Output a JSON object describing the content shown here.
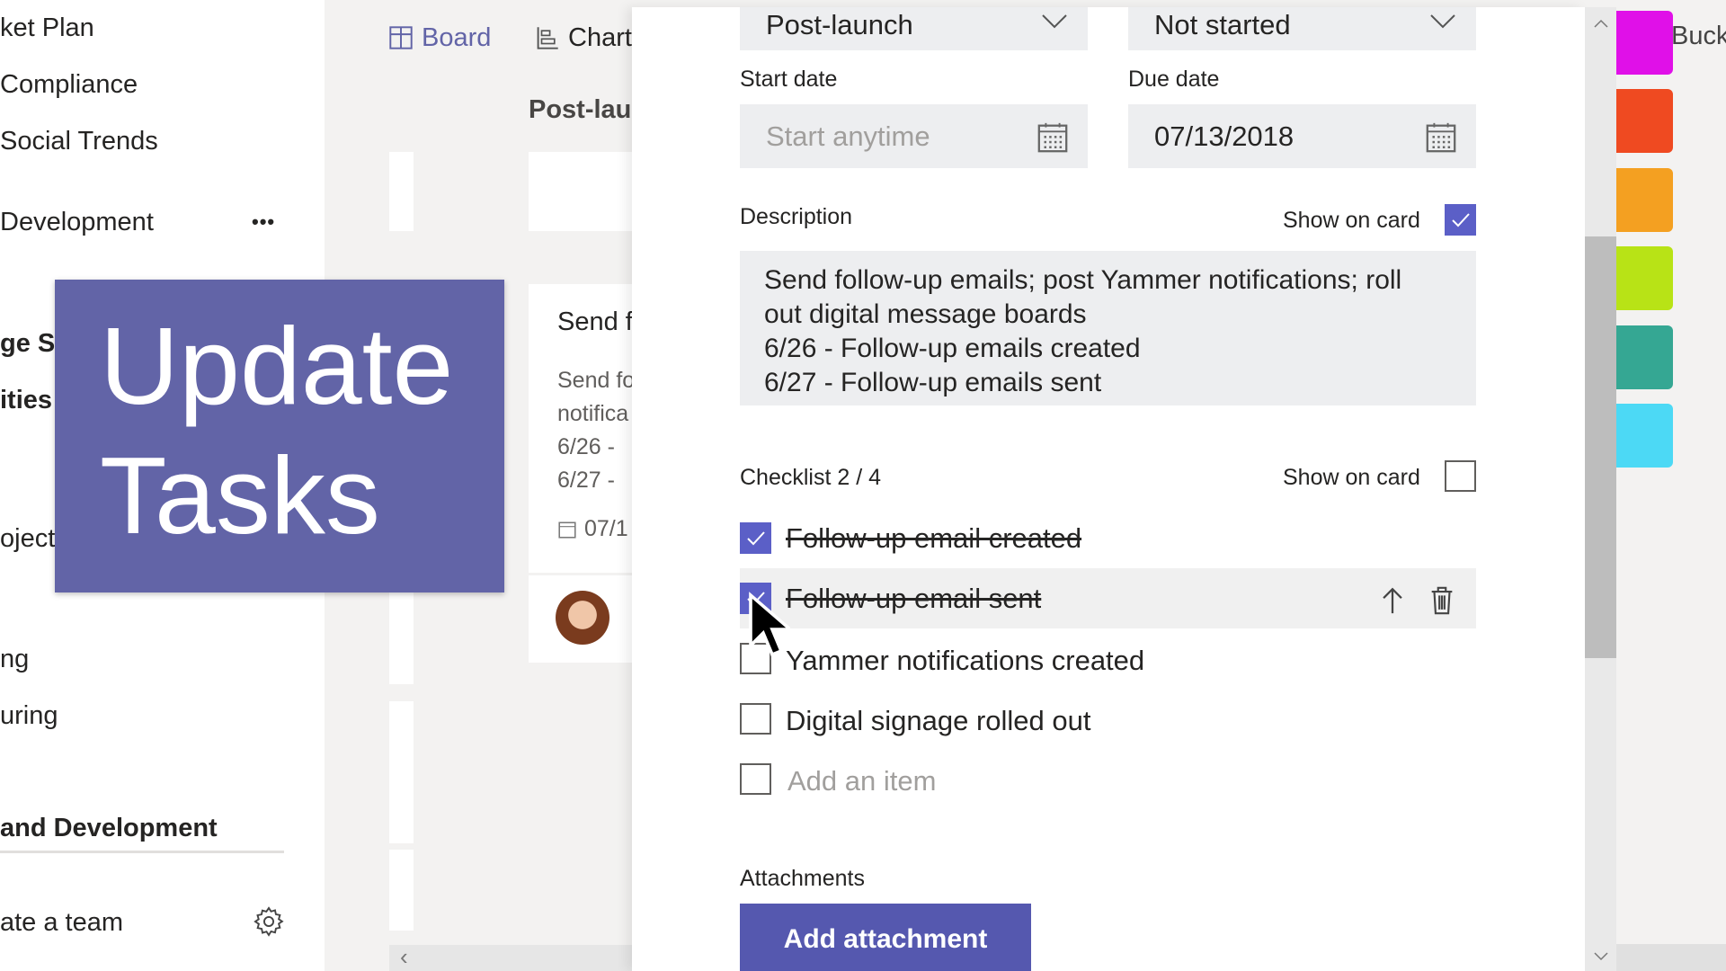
{
  "sidebar": {
    "items": [
      {
        "label": "ket Plan",
        "bold": false
      },
      {
        "label": "Compliance",
        "bold": false
      },
      {
        "label": "Social Trends",
        "bold": false
      },
      {
        "label": "Development",
        "bold": false
      },
      {
        "label": "ge Sh",
        "bold": true
      },
      {
        "label": "ities",
        "bold": true
      },
      {
        "label": "oject",
        "bold": false
      },
      {
        "label": "ng",
        "bold": false
      },
      {
        "label": "uring",
        "bold": false
      },
      {
        "label": "and Development",
        "bold": true
      }
    ],
    "more_label": "•••",
    "create_team": "ate a team"
  },
  "overlay": {
    "line1": "Update",
    "line2": "Tasks",
    "color": "#6264a7"
  },
  "tabs": [
    {
      "label": "Board",
      "icon": "board-icon",
      "active": true
    },
    {
      "label": "Chart",
      "icon": "chart-icon",
      "active": false
    }
  ],
  "board": {
    "bucket_title": "Post-lau",
    "card": {
      "title": "Send f",
      "desc": [
        "Send fo",
        "notifica",
        "6/26 - ",
        "6/27 - "
      ],
      "date": "07/1"
    }
  },
  "panel": {
    "bucket": "Post-launch",
    "progress": "Not started",
    "start_date_label": "Start date",
    "start_date_placeholder": "Start anytime",
    "due_date_label": "Due date",
    "due_date": "07/13/2018",
    "description_label": "Description",
    "show_on_card": "Show on card",
    "description_show_on_card": true,
    "description_lines": [
      "Send follow-up emails; post Yammer notifications; roll",
      "out digital message boards",
      "6/26 - Follow-up emails created",
      "6/27 - Follow-up emails sent"
    ],
    "checklist_label": "Checklist 2 / 4",
    "checklist_show_on_card": false,
    "checklist": [
      {
        "label": "Follow-up email created",
        "checked": true
      },
      {
        "label": "Follow-up email sent",
        "checked": true
      },
      {
        "label": "Yammer notifications created",
        "checked": false
      },
      {
        "label": "Digital signage rolled out",
        "checked": false
      }
    ],
    "add_item_placeholder": "Add an item",
    "attachments_label": "Attachments",
    "add_attachment": "Add attachment"
  },
  "right": {
    "label": "Buck",
    "swatches": [
      "#e010e8",
      "#ef4a21",
      "#f4a021",
      "#b8e316",
      "#35a793",
      "#4cd9f5"
    ]
  },
  "accent": "#5b5fc7"
}
